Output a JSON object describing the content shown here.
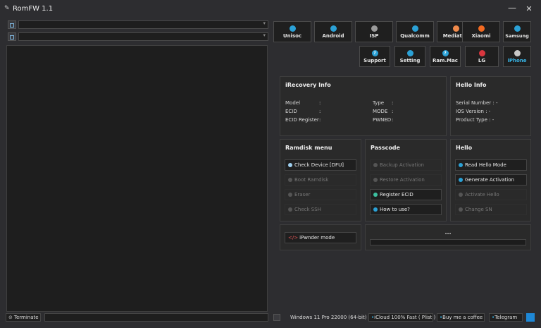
{
  "window": {
    "title": "RomFW 1.1",
    "minimize_glyph": "—",
    "close_glyph": "✕"
  },
  "left": {
    "combo1_value": "",
    "combo2_value": "",
    "log_text": ""
  },
  "tiles": [
    {
      "label": "Unisoc",
      "icon": "unisoc-icon",
      "color": "#2ba1d6"
    },
    {
      "label": "Android",
      "icon": "android-icon",
      "color": "#2ba1d6"
    },
    {
      "label": "ISP",
      "icon": "isp-icon",
      "color": "#9a9a9a"
    },
    {
      "label": "Qualcomm",
      "icon": "qualcomm-icon",
      "color": "#2ba1d6"
    },
    {
      "label": "Mediatek",
      "icon": "mediatek-icon",
      "color": "#f08a4b"
    },
    {
      "label": "Xiaomi",
      "icon": "xiaomi-icon",
      "color": "#f26a21"
    },
    {
      "label": "Samsung",
      "icon": "samsung-icon",
      "color": "#2ba1d6"
    },
    {
      "label": "Support",
      "icon": "support-icon",
      "color": "#2ba1d6"
    },
    {
      "label": "Setting",
      "icon": "setting-icon",
      "color": "#2ba1d6"
    },
    {
      "label": "Ram.Mac",
      "icon": "ram-mac-icon",
      "color": "#2ba1d6"
    },
    {
      "label": "LG",
      "icon": "lg-icon",
      "color": "#d9363e"
    },
    {
      "label": "iPhone",
      "icon": "apple-icon",
      "color": "#c8c8c8"
    }
  ],
  "irecovery": {
    "title": "iRecovery Info",
    "model_label": "Model",
    "model_sep": ":",
    "ecid_label": "ECID",
    "ecid_sep": ":",
    "ecidreg_label": "ECID Register",
    "ecidreg_sep": ":",
    "type_label": "Type",
    "type_sep": ":",
    "mode_label": "MODE",
    "mode_sep": ":",
    "pwned_label": "PWNED",
    "pwned_sep": ":"
  },
  "hello_info": {
    "title": "Hello Info",
    "serial": "Serial Number : -",
    "ios": "IOS Version    : -",
    "product": "Product Type  : -"
  },
  "ramdisk": {
    "title": "Ramdisk menu",
    "buttons": [
      "Check Device [DFU]",
      "Boot Ramdisk",
      "Eraser",
      "Check SSH"
    ]
  },
  "passcode": {
    "title": "Passcode",
    "buttons": [
      "Backup Activation",
      "Restore Activation",
      "Register ECID",
      "How to use?"
    ]
  },
  "hello": {
    "title": "Hello",
    "buttons": [
      "Read Hello Mode",
      "Generate Activation",
      "Activate Hello",
      "Change SN"
    ]
  },
  "ipwnder": {
    "label": "iPwnder mode",
    "icon_text": "</>"
  },
  "progress": {
    "label": "...",
    "value": 0
  },
  "statusbar": {
    "terminate": "Terminate",
    "os": "Windows 11 Pro 22000 (64-bit)",
    "icloud": "iCloud 100% Fast ( Plist )",
    "coffee": "Buy me a coffee",
    "telegram": "Telegram",
    "accent": "#1e88d6"
  }
}
